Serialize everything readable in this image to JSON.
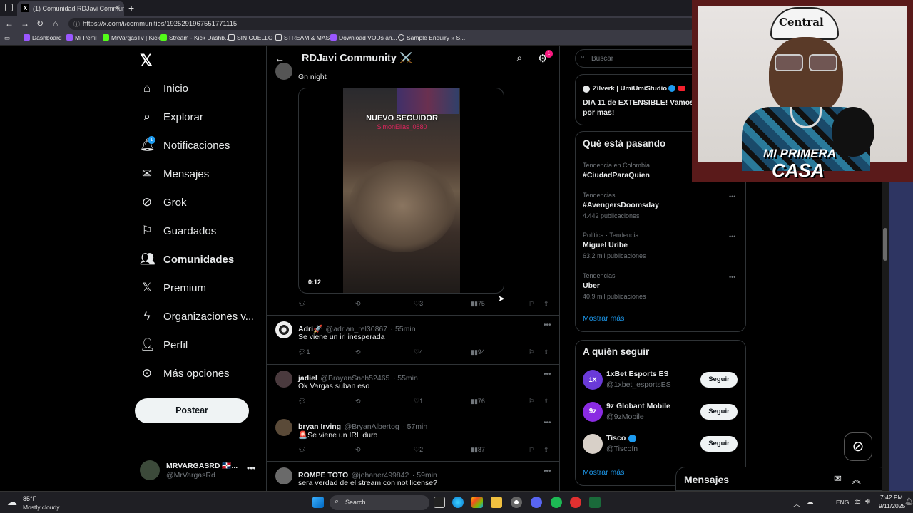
{
  "browser": {
    "tab_title": "(1) Comunidad RDJavi Communi",
    "url": "https://x.com/i/communities/1925291967551771115",
    "bookmarks": [
      "Dashboard",
      "Mi Perfil",
      "MrVargasTv | Kick",
      "Stream - Kick Dashb...",
      "SIN CUELLO",
      "STREAM & MAS",
      "Download VODs an...",
      "Sample Enquiry » S..."
    ]
  },
  "nav": {
    "items": [
      "Inicio",
      "Explorar",
      "Notificaciones",
      "Mensajes",
      "Grok",
      "Guardados",
      "Comunidades",
      "Premium",
      "Organizaciones v...",
      "Perfil",
      "Más opciones"
    ],
    "notif_badge": "1",
    "post_label": "Postear",
    "account_name": "MRVARGASRD 🇩🇴...",
    "account_handle": "@MrVargasRd"
  },
  "header": {
    "title": "RDJavi Community ⚔️",
    "settings_badge": "1"
  },
  "feed": {
    "first_post": {
      "text": "Gn night",
      "overlay_title": "NUEVO SEGUIDOR",
      "overlay_user": "SimonElias_0880",
      "duration": "0:12",
      "likes": "3",
      "views": "75"
    },
    "tweets": [
      {
        "name": "Adri🚀",
        "handle": "@adrian_rel30867",
        "time": "· 55min",
        "text": "Se viene un irl inesperada",
        "replies": "1",
        "likes": "4",
        "views": "94"
      },
      {
        "name": "jadiel",
        "handle": "@BrayanSnch52465",
        "time": "· 55min",
        "text": "Ok Vargas suban eso",
        "replies": "",
        "likes": "1",
        "views": "76"
      },
      {
        "name": "bryan Irving",
        "handle": "@BryanAlbertog",
        "time": "· 57min",
        "text": "🚨Se viene un IRL duro",
        "replies": "",
        "likes": "2",
        "views": "87"
      },
      {
        "name": "ROMPE TOTO",
        "handle": "@johaner499842",
        "time": "· 59min",
        "text": "sera verdad de el stream con not license?"
      }
    ]
  },
  "sidebar": {
    "search_placeholder": "Buscar",
    "live_user": "Zilverk | UmiUmiStudio",
    "live_text": "DIA 11 de EXTENSIBLE! Vamos por mas!",
    "trends_title": "Qué está pasando",
    "trends": [
      {
        "meta": "Tendencia en Colombia",
        "name": "#CiudadParaQuien",
        "count": ""
      },
      {
        "meta": "Tendencias",
        "name": "#AvengersDoomsday",
        "count": "4.442 publicaciones"
      },
      {
        "meta": "Política · Tendencia",
        "name": "Miguel Uribe",
        "count": "63,2 mil publicaciones"
      },
      {
        "meta": "Tendencias",
        "name": "Uber",
        "count": "40,9 mil publicaciones"
      }
    ],
    "show_more": "Mostrar más",
    "follow_title": "A quién seguir",
    "follow": [
      {
        "name": "1xBet Esports ES",
        "handle": "@1xbet_esportsES",
        "btn": "Seguir"
      },
      {
        "name": "9z Globant Mobile",
        "handle": "@9zMobile",
        "btn": "Seguir"
      },
      {
        "name": "Tisco",
        "handle": "@Tiscofn",
        "btn": "Seguir"
      }
    ],
    "follow_more": "Mostrar más"
  },
  "messages_bar": {
    "label": "Mensajes"
  },
  "webcam": {
    "overlay_text_1": "MI PRIMERA",
    "overlay_text_2": "CASA",
    "hat_text": "Central"
  },
  "taskbar": {
    "weather_temp": "85°F",
    "weather_desc": "Mostly cloudy",
    "search": "Search",
    "lang": "ENG",
    "time": "7:42 PM",
    "date": "9/11/2025"
  }
}
